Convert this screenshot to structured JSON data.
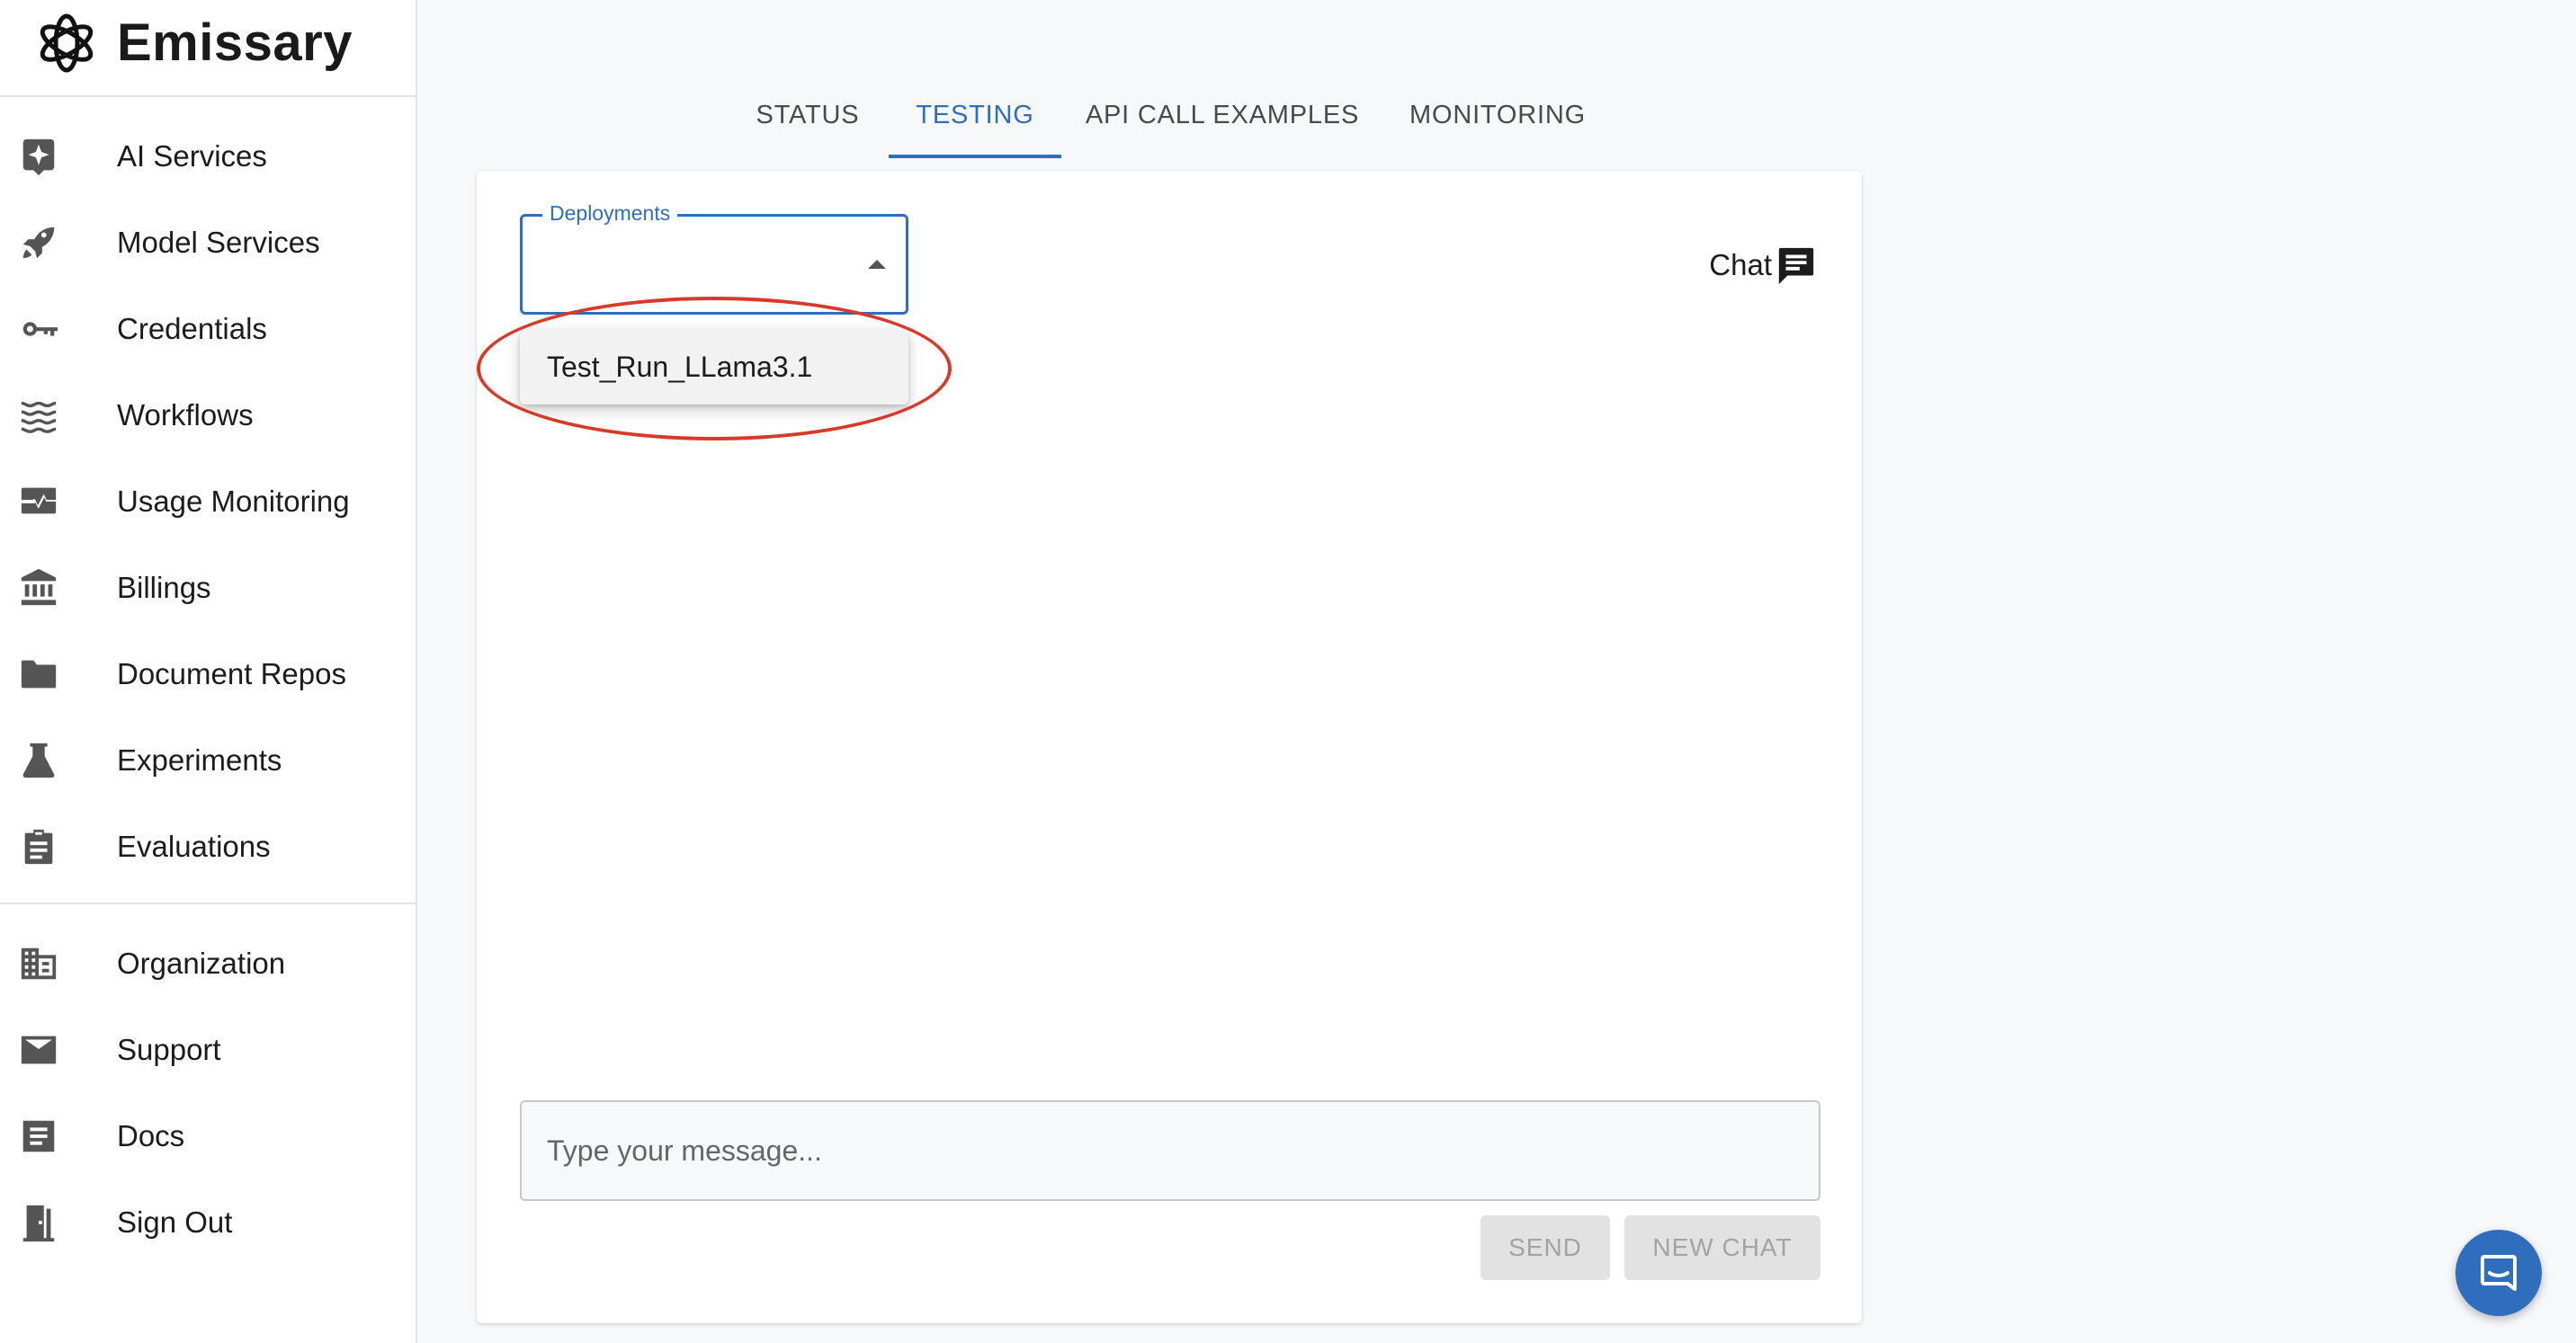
{
  "app": {
    "name": "Emissary"
  },
  "sidebar": {
    "items": [
      {
        "label": "AI Services",
        "icon": "sparkle-badge-icon"
      },
      {
        "label": "Model Services",
        "icon": "rocket-icon"
      },
      {
        "label": "Credentials",
        "icon": "key-icon"
      },
      {
        "label": "Workflows",
        "icon": "waves-icon"
      },
      {
        "label": "Usage Monitoring",
        "icon": "monitor-heart-icon"
      },
      {
        "label": "Billings",
        "icon": "bank-icon"
      },
      {
        "label": "Document Repos",
        "icon": "folder-icon"
      },
      {
        "label": "Experiments",
        "icon": "flask-icon"
      },
      {
        "label": "Evaluations",
        "icon": "clipboard-icon"
      }
    ],
    "bottom_items": [
      {
        "label": "Organization",
        "icon": "building-icon"
      },
      {
        "label": "Support",
        "icon": "mail-icon"
      },
      {
        "label": "Docs",
        "icon": "document-icon"
      },
      {
        "label": "Sign Out",
        "icon": "door-exit-icon"
      }
    ]
  },
  "tabs": [
    {
      "label": "STATUS",
      "active": false
    },
    {
      "label": "TESTING",
      "active": true
    },
    {
      "label": "API CALL EXAMPLES",
      "active": false
    },
    {
      "label": "MONITORING",
      "active": false
    }
  ],
  "testing": {
    "deployments_label": "Deployments",
    "deployments_value": "",
    "dropdown_options": [
      "Test_Run_LLama3.1"
    ],
    "chat_label": "Chat",
    "message_placeholder": "Type your message...",
    "send_label": "SEND",
    "new_chat_label": "NEW CHAT"
  },
  "colors": {
    "accent": "#2f6dbd",
    "annotation": "#d63b2a",
    "disabled_bg": "#e2e2e2",
    "disabled_text": "#a3a3a3"
  }
}
